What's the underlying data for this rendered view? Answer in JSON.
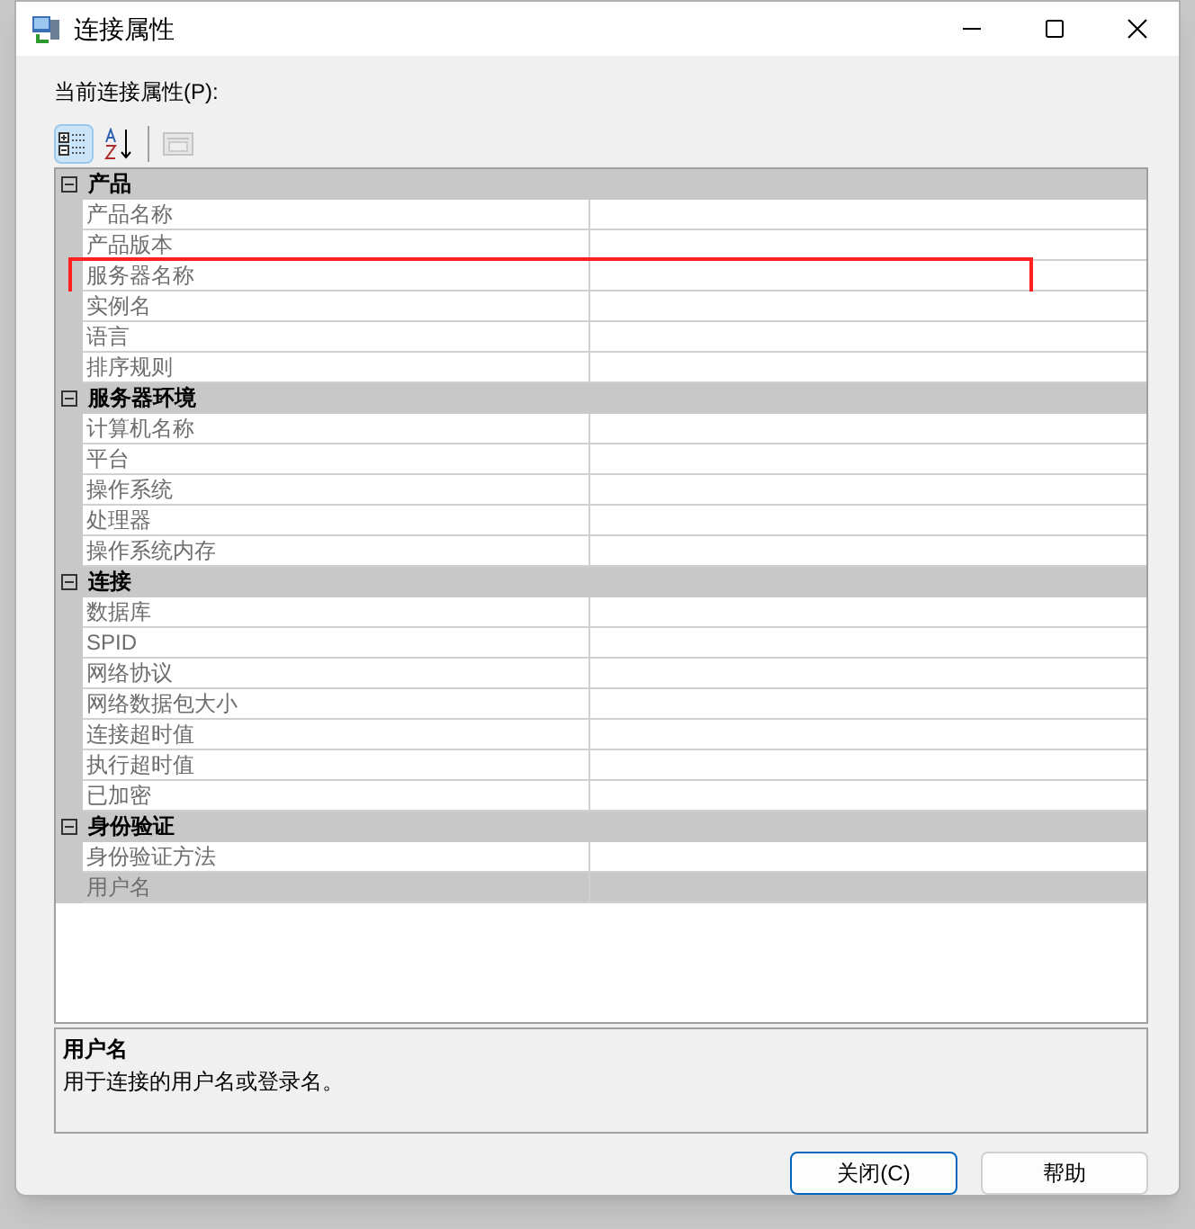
{
  "window": {
    "title": "连接属性"
  },
  "grid_label": "当前连接属性(P):",
  "toolbar": [
    {
      "kind": "categorized",
      "selected": true,
      "disabled": false
    },
    {
      "kind": "alphabetical",
      "selected": false,
      "disabled": false
    },
    {
      "kind": "pages",
      "selected": false,
      "disabled": true
    }
  ],
  "categories": [
    {
      "name": "产品",
      "expanded": true,
      "items": [
        {
          "name": "产品名称",
          "selected": false,
          "annotated": false
        },
        {
          "name": "产品版本",
          "selected": false,
          "annotated": false
        },
        {
          "name": "服务器名称",
          "selected": false,
          "annotated": true
        },
        {
          "name": "实例名",
          "selected": false,
          "annotated": false
        },
        {
          "name": "语言",
          "selected": false,
          "annotated": false
        },
        {
          "name": "排序规则",
          "selected": false,
          "annotated": false
        }
      ]
    },
    {
      "name": "服务器环境",
      "expanded": true,
      "items": [
        {
          "name": "计算机名称",
          "selected": false,
          "annotated": false
        },
        {
          "name": "平台",
          "selected": false,
          "annotated": false
        },
        {
          "name": "操作系统",
          "selected": false,
          "annotated": false
        },
        {
          "name": "处理器",
          "selected": false,
          "annotated": false
        },
        {
          "name": "操作系统内存",
          "selected": false,
          "annotated": false
        }
      ]
    },
    {
      "name": "连接",
      "expanded": true,
      "items": [
        {
          "name": "数据库",
          "selected": false,
          "annotated": false
        },
        {
          "name": "SPID",
          "selected": false,
          "annotated": false
        },
        {
          "name": "网络协议",
          "selected": false,
          "annotated": false
        },
        {
          "name": "网络数据包大小",
          "selected": false,
          "annotated": false
        },
        {
          "name": "连接超时值",
          "selected": false,
          "annotated": false
        },
        {
          "name": "执行超时值",
          "selected": false,
          "annotated": false
        },
        {
          "name": "已加密",
          "selected": false,
          "annotated": false
        }
      ]
    },
    {
      "name": "身份验证",
      "expanded": true,
      "items": [
        {
          "name": "身份验证方法",
          "selected": false,
          "annotated": false
        },
        {
          "name": "用户名",
          "selected": true,
          "annotated": false
        }
      ]
    }
  ],
  "description": {
    "title": "用户名",
    "text": "用于连接的用户名或登录名。"
  },
  "buttons": [
    {
      "label": "关闭(C)",
      "default": true
    },
    {
      "label": "帮助",
      "default": false
    }
  ]
}
